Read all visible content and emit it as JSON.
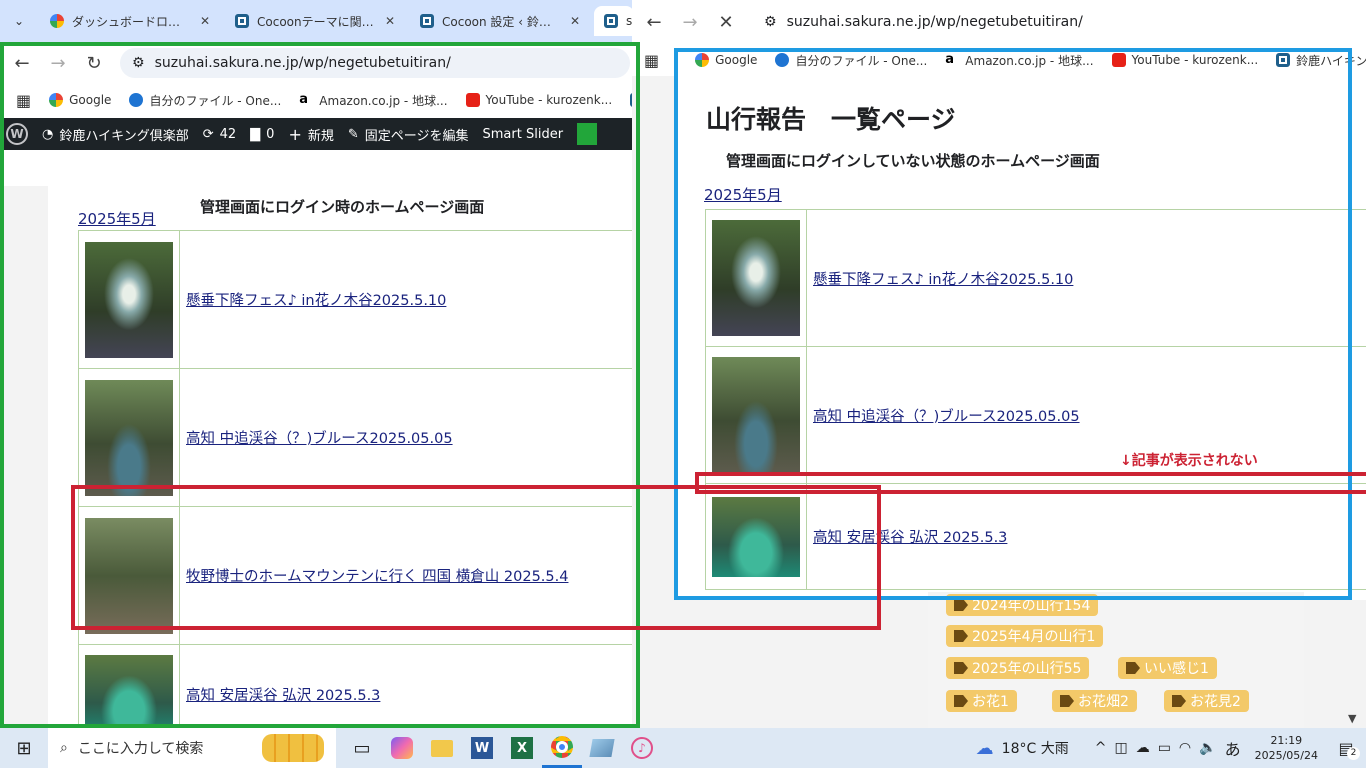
{
  "tabs": [
    {
      "label": "ダッシュボードログイン時と"
    },
    {
      "label": "Cocoonテーマに関する新"
    },
    {
      "label": "Cocoon 設定 ‹ 鈴鹿ハ"
    },
    {
      "label": "s"
    }
  ],
  "left_window": {
    "url": "suzuhai.sakura.ne.jp/wp/negetubetuitiran/",
    "bookmarks": [
      "Google",
      "自分のファイル - One...",
      "Amazon.co.jp - 地球...",
      "YouTube - kurozenk...",
      "鈴"
    ],
    "admin_bar": {
      "site": "鈴鹿ハイキング倶楽部",
      "updates": "42",
      "comments": "0",
      "new": "新規",
      "edit": "固定ページを編集",
      "slider": "Smart Slider"
    },
    "caption": "管理画面にログイン時のホームページ画面",
    "month_link": "2025年5月",
    "posts": [
      {
        "title": "懸垂下降フェス♪ in花ノ木谷2025.5.10"
      },
      {
        "title": "高知 中追渓谷（？)ブルース2025.05.05"
      },
      {
        "title": "牧野博士のホームマウンテンに行く 四国 横倉山 2025.5.4"
      },
      {
        "title": "高知 安居渓谷 弘沢 2025.5.3"
      }
    ]
  },
  "right_window": {
    "url": "suzuhai.sakura.ne.jp/wp/negetubetuitiran/",
    "bookmarks": [
      "Google",
      "自分のファイル - One...",
      "Amazon.co.jp - 地球...",
      "YouTube - kurozenk...",
      "鈴鹿ハイキング倶楽部"
    ],
    "page_title": "山行報告　一覧ページ",
    "caption": "管理画面にログインしていない状態のホームページ画面",
    "month_link": "2025年5月",
    "posts": [
      {
        "title": "懸垂下降フェス♪ in花ノ木谷2025.5.10"
      },
      {
        "title": "高知 中追渓谷（？)ブルース2025.05.05"
      },
      {
        "title": "高知 安居渓谷 弘沢 2025.5.3"
      }
    ],
    "note": "↓記事が表示されない",
    "tags": [
      "2024年の山行154",
      "2025年4月の山行1",
      "2025年の山行55",
      "いい感じ1",
      "お花1",
      "お花畑2",
      "お花見2"
    ]
  },
  "taskbar": {
    "search_placeholder": "ここに入力して検索",
    "weather": "18°C 大雨",
    "ime": "あ",
    "time": "21:19",
    "date": "2025/05/24",
    "notifications": "2"
  },
  "colors": {
    "green_box": "#22a63a",
    "blue_box": "#1e9be2",
    "red_box": "#cc2233",
    "admin_bar": "#1d2327",
    "tag": "#f3c969"
  }
}
